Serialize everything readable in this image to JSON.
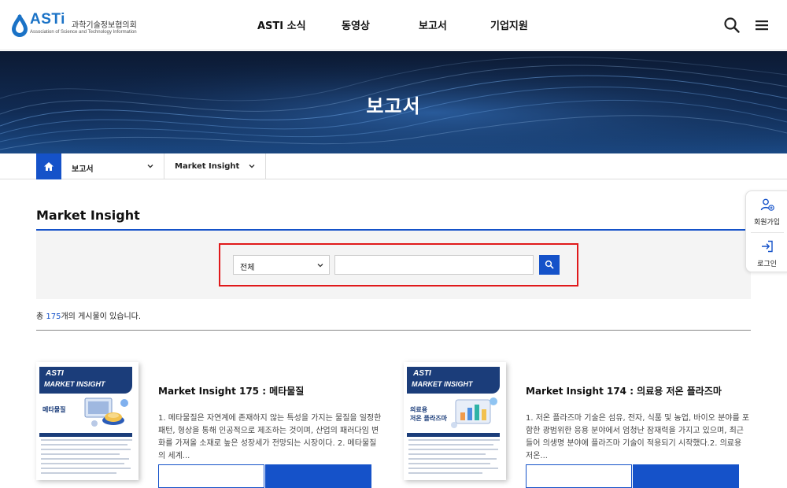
{
  "header": {
    "logo": {
      "brand": "ASTi",
      "org_name_kr": "과학기술정보협의회",
      "org_name_en": "Association of Science and Technology Information"
    },
    "nav": [
      {
        "label": "ASTI 소식"
      },
      {
        "label": "동영상"
      },
      {
        "label": "보고서"
      },
      {
        "label": "기업지원"
      }
    ],
    "icons": {
      "search": "search-icon",
      "menu": "hamburger-menu-icon"
    }
  },
  "banner": {
    "title": "보고서"
  },
  "breadcrumb": {
    "home_icon": "home-icon",
    "items": [
      {
        "label": "보고서"
      },
      {
        "label": "Market Insight"
      }
    ]
  },
  "page": {
    "title": "Market Insight"
  },
  "search": {
    "category": {
      "selected": "전체"
    },
    "input": {
      "value": "",
      "placeholder": ""
    },
    "button_icon": "search-icon"
  },
  "list_summary": {
    "prefix": "총 ",
    "count": "175",
    "suffix": "개의 게시물이 있습니다."
  },
  "cards": [
    {
      "title": "Market Insight 175 : 메타물질",
      "description": "1. 메타물질은 자연계에 존재하지 않는 특성을 가지는 물질을 일정한 패턴, 형상을 통해 인공적으로 제조하는 것이며, 산업의 패러다임 변화를 가져올 소재로 높은 성장세가 전망되는 시장이다. 2. 메타물질의 세계...",
      "thumbnail": {
        "brand": "ASTI",
        "series": "MARKET INSIGHT",
        "topic": "메타물질"
      }
    },
    {
      "title": "Market Insight 174 : 의료용 저온 플라즈마",
      "description": "1. 저온 플라즈마 기술은 섬유, 전자, 식품 및 농업, 바이오 분야를 포함한 광범위한 응용 분야에서 엄청난 잠재력을 가지고 있으며, 최근 들어 의생명 분야에 플라즈마 기술이 적용되기 시작했다.2. 의료용 저온...",
      "thumbnail": {
        "brand": "ASTI",
        "series": "MARKET INSIGHT",
        "topic": "의료용\n저온 플라즈마"
      }
    }
  ],
  "quick_menu": [
    {
      "label": "회원가입",
      "icon": "user-add-icon"
    },
    {
      "label": "로그인",
      "icon": "login-icon"
    }
  ],
  "colors": {
    "accent": "#1552c9",
    "brand": "#1a72c6",
    "highlight": "#e0191b",
    "banner_dark": "#0c1a33"
  }
}
